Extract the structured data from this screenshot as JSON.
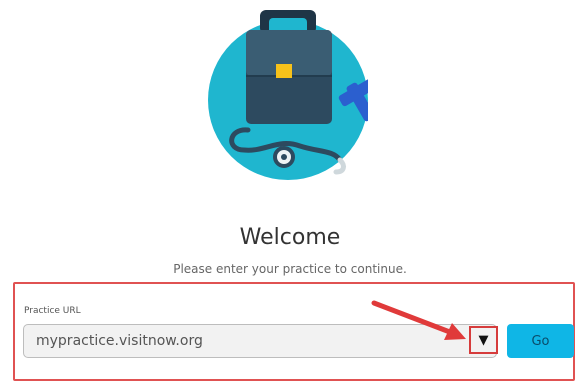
{
  "welcome": {
    "title": "Welcome",
    "subtitle": "Please enter your practice to continue."
  },
  "form": {
    "label": "Practice URL",
    "url_value": "mypractice.visitnow.org",
    "dropdown_glyph": "▼",
    "go_label": "Go"
  },
  "colors": {
    "hero_circle": "#1fb6cf",
    "bag": "#2d4a5f",
    "accent_red": "#e05252",
    "go_button": "#0fb6e6"
  },
  "icons": {
    "hero": "medical-bag-stethoscope-illustration",
    "dropdown": "chevron-down-icon",
    "annotation": "red-arrow-icon"
  }
}
